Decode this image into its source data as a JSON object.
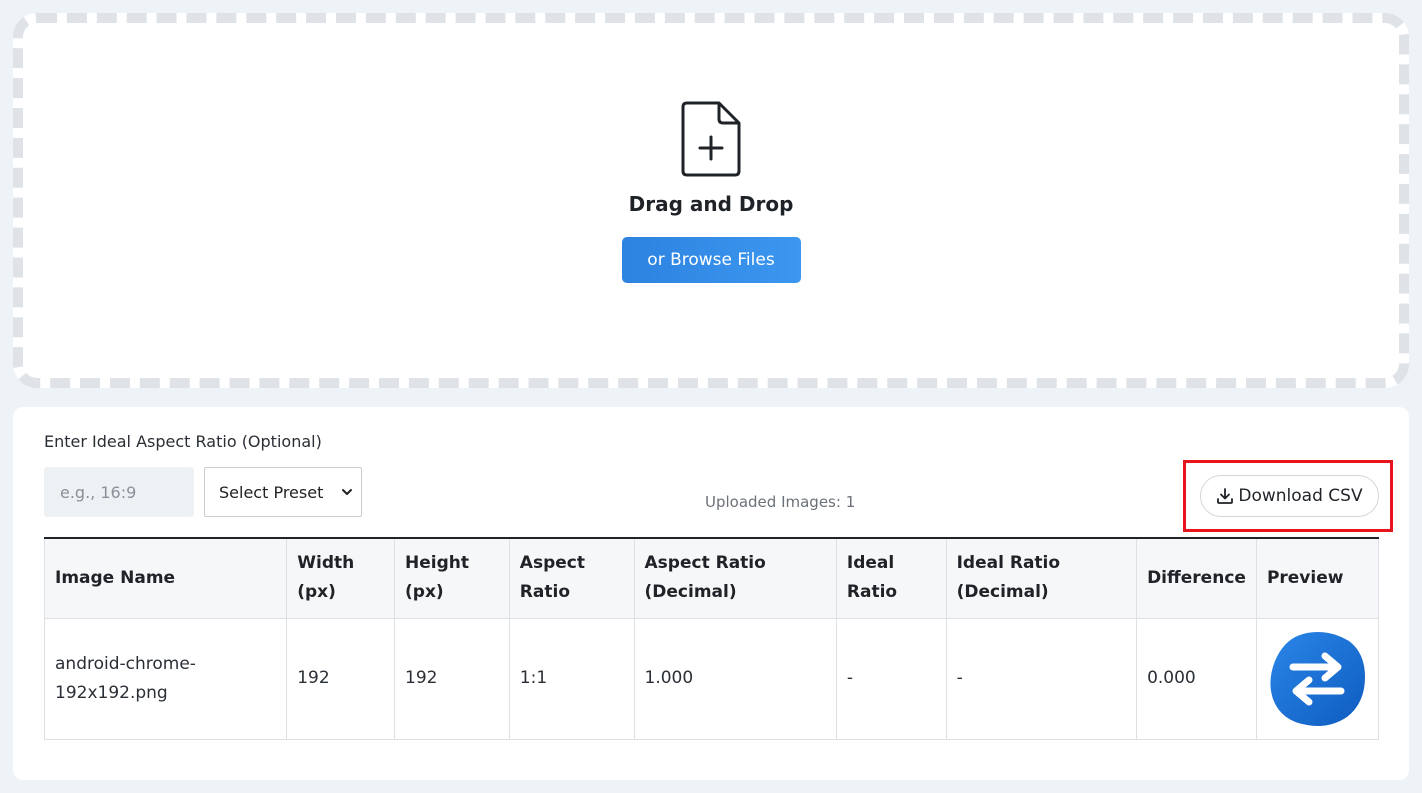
{
  "dropzone": {
    "icon": "file-plus-icon",
    "title": "Drag and Drop",
    "browse_label": "or Browse Files"
  },
  "controls": {
    "ratio_label": "Enter Ideal Aspect Ratio (Optional)",
    "ratio_placeholder": "e.g., 16:9",
    "preset_selected": "Select Preset",
    "uploaded_text": "Uploaded Images: 1",
    "download_label": "Download CSV"
  },
  "table": {
    "headers": [
      {
        "line1": "Image Name",
        "line2": ""
      },
      {
        "line1": "Width",
        "line2": "(px)"
      },
      {
        "line1": "Height",
        "line2": "(px)"
      },
      {
        "line1": "Aspect",
        "line2": "Ratio"
      },
      {
        "line1": "Aspect Ratio",
        "line2": "(Decimal)"
      },
      {
        "line1": "Ideal",
        "line2": "Ratio"
      },
      {
        "line1": "Ideal Ratio",
        "line2": "(Decimal)"
      },
      {
        "line1": "Difference",
        "line2": ""
      },
      {
        "line1": "Preview",
        "line2": ""
      }
    ],
    "rows": [
      {
        "name_line1": "android-chrome-",
        "name_line2": "192x192.png",
        "width": "192",
        "height": "192",
        "aspect_ratio": "1:1",
        "aspect_decimal": "1.000",
        "ideal_ratio": "-",
        "ideal_decimal": "-",
        "difference": "0.000",
        "preview_icon": "swap-arrows-logo"
      }
    ]
  },
  "colors": {
    "accent": "#2d83e0",
    "highlight": "#e8141c",
    "logo_blue": "#1a73d9"
  }
}
